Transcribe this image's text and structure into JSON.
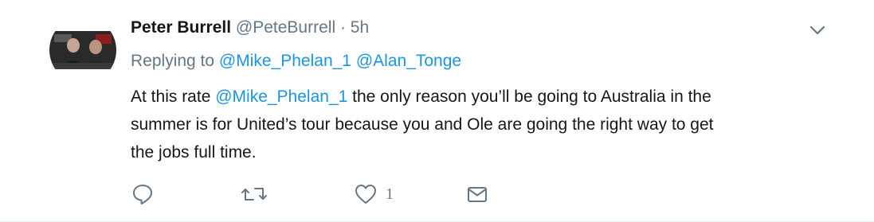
{
  "tweet": {
    "author_name": "Peter Burrell",
    "author_handle": "@PeteBurrell",
    "separator": "·",
    "time": "5h",
    "replying_prefix": "Replying to",
    "replying_to": [
      "@Mike_Phelan_1",
      "@Alan_Tonge"
    ],
    "body_lines": [
      {
        "before": "At this rate ",
        "mention": "@Mike_Phelan_1",
        "after": " the only reason you’ll be going to Australia in the"
      },
      {
        "text": "summer is for United’s tour because you and Ole are going the right way to get"
      },
      {
        "text": "the jobs full time."
      }
    ],
    "like_count": "1"
  },
  "icons": {
    "menu": "chevron-down-icon",
    "reply": "reply-icon",
    "retweet": "retweet-icon",
    "like": "heart-icon",
    "dm": "envelope-icon"
  },
  "colors": {
    "link": "#1b95e0",
    "text": "#14171a",
    "muted": "#657786"
  }
}
